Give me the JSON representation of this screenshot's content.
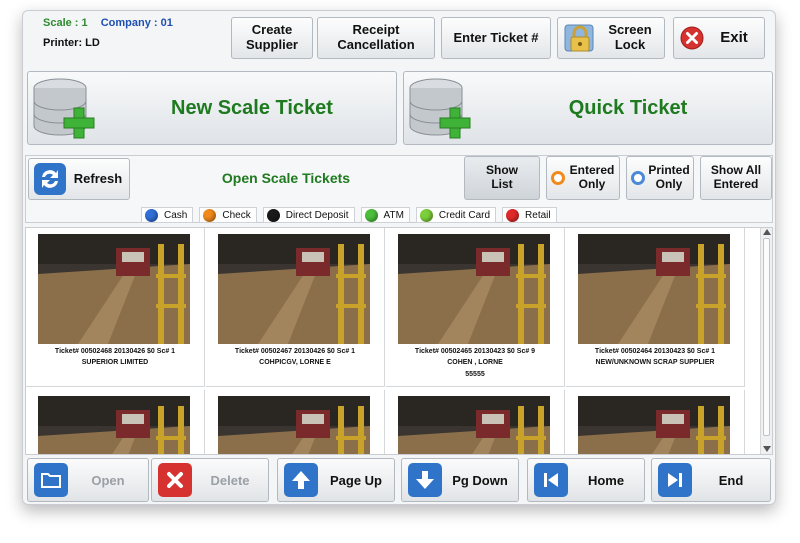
{
  "header": {
    "scale_label": "Scale : 1",
    "company_label": "Company : 01",
    "printer_label": "Printer: LD",
    "buttons": {
      "create_supplier": "Create\nSupplier",
      "receipt_cancellation": "Receipt\nCancellation",
      "enter_ticket": "Enter Ticket #",
      "screen_lock": "Screen\nLock",
      "exit": "Exit"
    }
  },
  "main": {
    "new_scale_ticket": "New Scale Ticket",
    "quick_ticket": "Quick Ticket"
  },
  "section": {
    "refresh": "Refresh",
    "title": "Open Scale Tickets",
    "show_list": "Show\nList",
    "entered_only": "Entered\nOnly",
    "printed_only": "Printed\nOnly",
    "show_all_entered": "Show All\nEntered"
  },
  "legend": [
    {
      "label": "Cash",
      "color": "#2f6fd6"
    },
    {
      "label": "Check",
      "color": "#f08a1c"
    },
    {
      "label": "Direct Deposit",
      "color": "#1a1a1a"
    },
    {
      "label": "ATM",
      "color": "#4cbf3a"
    },
    {
      "label": "Credit Card",
      "color": "#7ccf3a"
    },
    {
      "label": "Retail",
      "color": "#e02a2a"
    }
  ],
  "tickets": [
    {
      "meta": "Ticket# 00502468    20130426    $0    Sc# 1",
      "name": "SUPERIOR LIMITED",
      "extra": ""
    },
    {
      "meta": "Ticket# 00502467    20130426    $0    Sc# 1",
      "name": "COHPICGV, LORNE E",
      "extra": ""
    },
    {
      "meta": "Ticket# 00502465    20130423    $0    Sc# 9",
      "name": "COHEN , LORNE",
      "extra": "55555"
    },
    {
      "meta": "Ticket# 00502464    20130423    $0    Sc# 1",
      "name": "NEW/UNKNOWN SCRAP SUPPLIER",
      "extra": ""
    }
  ],
  "footer": {
    "open": "Open",
    "delete": "Delete",
    "page_up": "Page Up",
    "pg_down": "Pg Down",
    "home": "Home",
    "end": "End"
  }
}
